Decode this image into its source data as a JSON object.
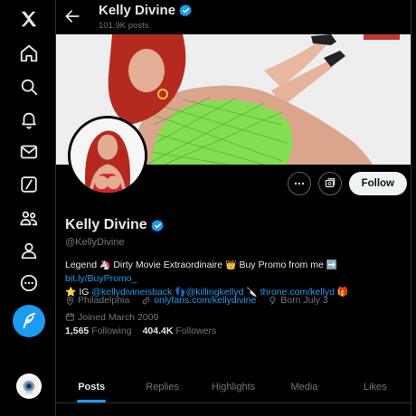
{
  "header": {
    "title": "Kelly Divine",
    "subtitle": "101.9K posts"
  },
  "profile": {
    "name": "Kelly Divine",
    "handle": "@KellyDivine",
    "follow_label": "Follow",
    "bio": {
      "line1_text1": "Legend",
      "line1_text2": "Dirty Movie Extraordinaire",
      "line1_text3": "Buy Promo from me",
      "line1_link": "bit.ly/BuyPromo_",
      "line2_text1": "IG",
      "line2_link1": "@kellydivineisback",
      "line2_link2": "@killingkellyd",
      "line2_link3": "throne.com/kellyd"
    },
    "location": "Philadelphia",
    "website": "onlyfans.com/kellydivine",
    "birthday": "Born July 3",
    "joined": "Joined March 2009",
    "following_count": "1,565",
    "following_label": "Following",
    "followers_count": "404.4K",
    "followers_label": "Followers"
  },
  "tabs": [
    {
      "label": "Posts"
    },
    {
      "label": "Replies"
    },
    {
      "label": "Highlights"
    },
    {
      "label": "Media"
    },
    {
      "label": "Likes"
    }
  ],
  "nav": {
    "items": [
      "x-logo-icon",
      "home-icon",
      "search-icon",
      "notifications-icon",
      "messages-icon",
      "grok-icon",
      "communities-icon",
      "profile-icon",
      "more-icon"
    ]
  },
  "colors": {
    "accent": "#1d9bf0",
    "background": "#000000",
    "text": "#e7e9ea",
    "muted": "#71767b"
  }
}
